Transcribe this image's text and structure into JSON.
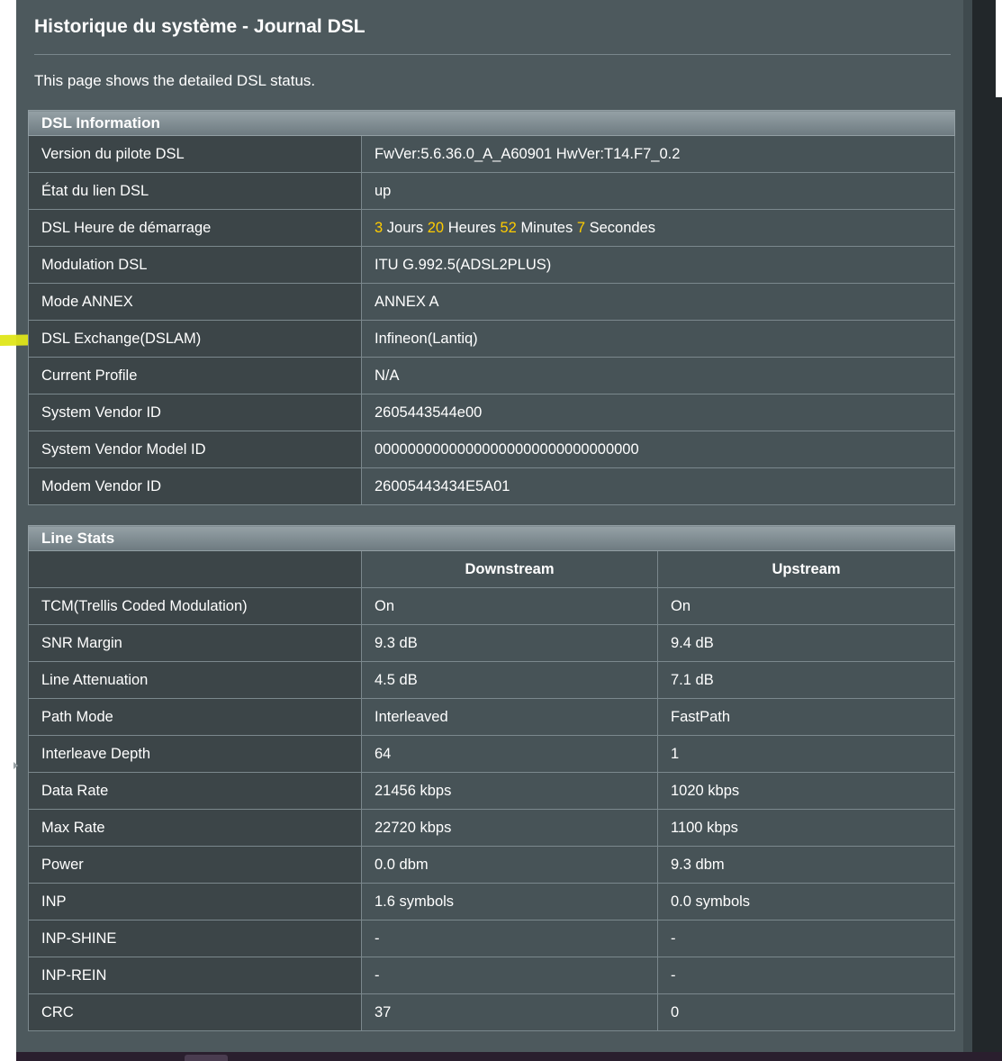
{
  "page": {
    "title": "Historique du système - Journal DSL",
    "description": "This page shows the detailed DSL status."
  },
  "colors": {
    "panel_bg": "#4d595d",
    "label_cell_bg": "#3c4548",
    "value_cell_bg": "#475357",
    "accent_number": "#ffcc00",
    "highlighter": "#dfe619"
  },
  "dsl_info": {
    "header": "DSL Information",
    "rows": [
      {
        "label": "Version du pilote DSL",
        "value": "FwVer:5.6.36.0_A_A60901 HwVer:T14.F7_0.2"
      },
      {
        "label": "État du lien DSL",
        "value": "up"
      },
      {
        "label": "DSL Heure de démarrage",
        "value": ""
      },
      {
        "label": "Modulation DSL",
        "value": "ITU G.992.5(ADSL2PLUS)"
      },
      {
        "label": "Mode ANNEX",
        "value": "ANNEX A"
      },
      {
        "label": "DSL Exchange(DSLAM)",
        "value": "Infineon(Lantiq)"
      },
      {
        "label": "Current Profile",
        "value": "N/A"
      },
      {
        "label": "System Vendor ID",
        "value": "2605443544e00"
      },
      {
        "label": "System Vendor Model ID",
        "value": "00000000000000000000000000000000"
      },
      {
        "label": "Modem Vendor ID",
        "value": "26005443434E5A01"
      }
    ],
    "uptime": {
      "days": "3",
      "days_unit": "Jours",
      "hours": "20",
      "hours_unit": "Heures",
      "minutes": "52",
      "minutes_unit": "Minutes",
      "seconds": "7",
      "seconds_unit": "Secondes"
    }
  },
  "line_stats": {
    "header": "Line Stats",
    "columns": [
      "",
      "Downstream",
      "Upstream"
    ],
    "rows": [
      {
        "label": "TCM(Trellis Coded Modulation)",
        "down": "On",
        "up": "On"
      },
      {
        "label": "SNR Margin",
        "down": "9.3 dB",
        "up": "9.4 dB"
      },
      {
        "label": "Line Attenuation",
        "down": "4.5 dB",
        "up": "7.1 dB"
      },
      {
        "label": "Path Mode",
        "down": "Interleaved",
        "up": "FastPath"
      },
      {
        "label": "Interleave Depth",
        "down": "64",
        "up": "1"
      },
      {
        "label": "Data Rate",
        "down": "21456 kbps",
        "up": "1020 kbps"
      },
      {
        "label": "Max Rate",
        "down": "22720 kbps",
        "up": "1100 kbps"
      },
      {
        "label": "Power",
        "down": "0.0 dbm",
        "up": "9.3 dbm"
      },
      {
        "label": "INP",
        "down": "1.6 symbols",
        "up": "0.0 symbols"
      },
      {
        "label": "INP-SHINE",
        "down": "-",
        "up": "-"
      },
      {
        "label": "INP-REIN",
        "down": "-",
        "up": "-"
      },
      {
        "label": "CRC",
        "down": "37",
        "up": "0"
      }
    ]
  }
}
